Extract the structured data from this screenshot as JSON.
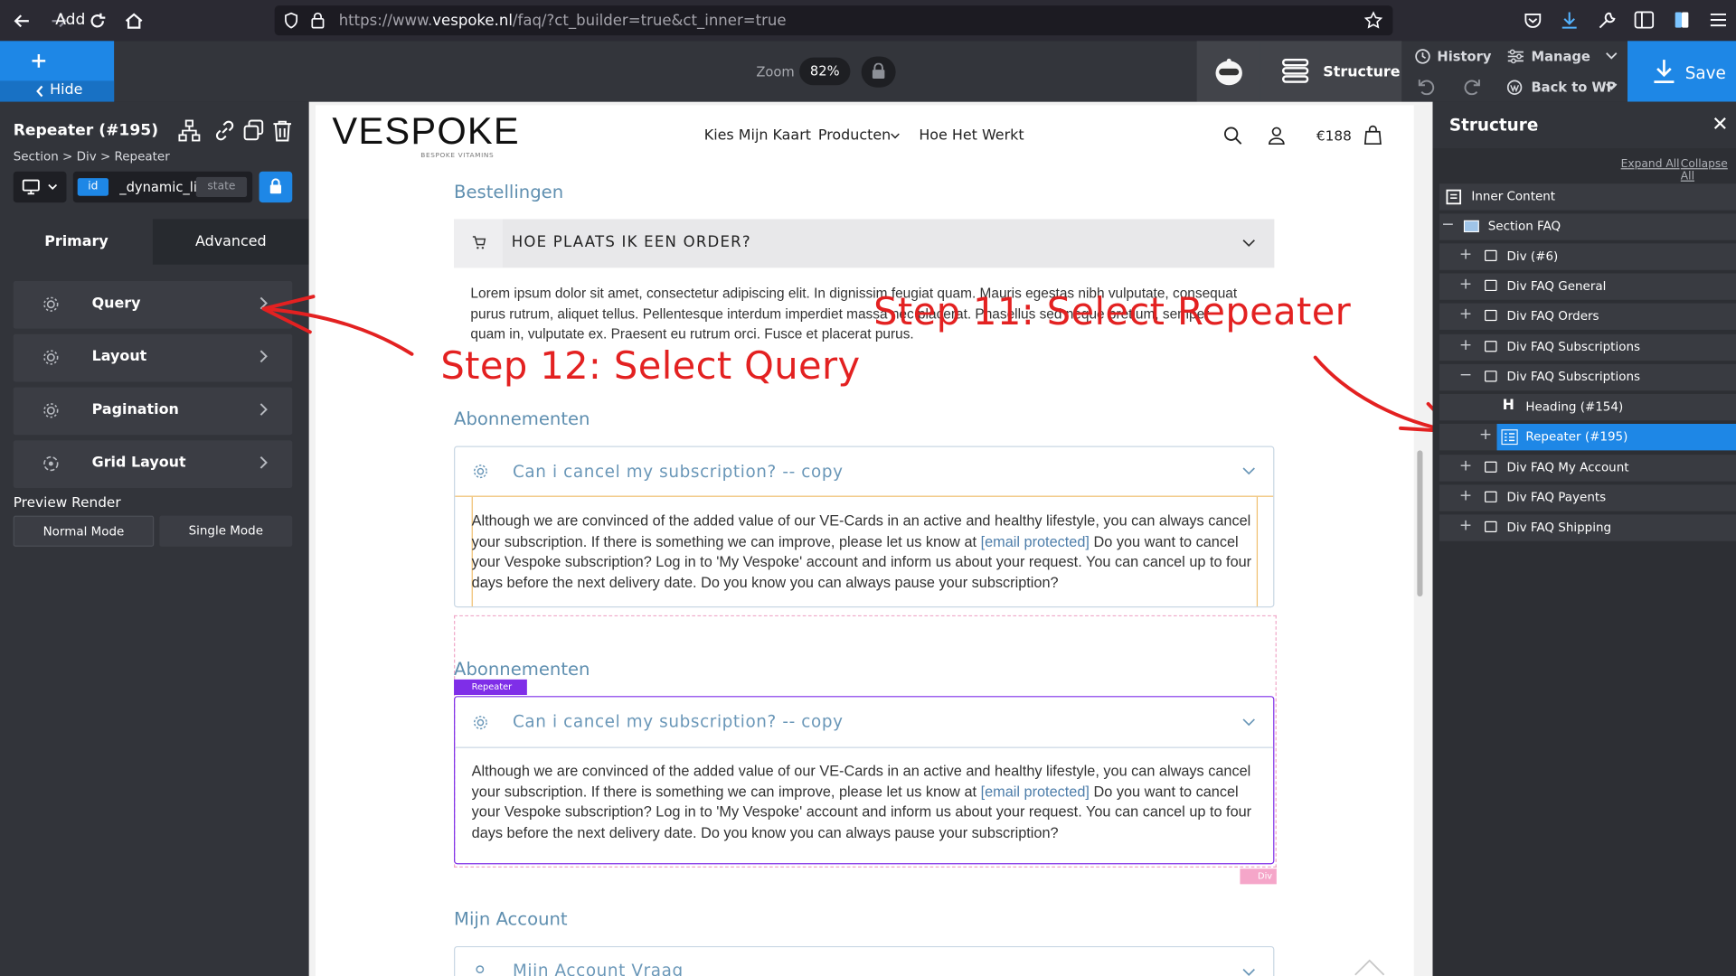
{
  "browser": {
    "url_prefix": "https://www.",
    "url_host": "vespoke.nl",
    "url_path": "/faq/?ct_builder=true&ct_inner=true"
  },
  "toolbar": {
    "add_label": "Add",
    "hide_label": "Hide",
    "zoom_label": "Zoom",
    "zoom_value": "82%",
    "structure_label": "Structure",
    "history_label": "History",
    "manage_label": "Manage",
    "back_label": "Back to WP",
    "save_label": "Save"
  },
  "left_panel": {
    "title": "Repeater (#195)",
    "breadcrumb": "Section > Div > Repeater",
    "id_tag": "id",
    "id_value": "_dynamic_li",
    "state_tag": "state",
    "tabs": [
      "Primary",
      "Advanced"
    ],
    "sections": [
      "Query",
      "Layout",
      "Pagination",
      "Grid Layout"
    ],
    "preview_label": "Preview Render",
    "modes": [
      "Normal Mode",
      "Single Mode"
    ]
  },
  "page": {
    "logo": "VESPOKE",
    "logo_sub": "BESPOKE VITAMINS",
    "nav": [
      "Kies Mijn Kaart",
      "Producten",
      "Hoe Het Werkt"
    ],
    "cart_amount": "€188",
    "sections": {
      "orders": "Bestellingen",
      "subs1": "Abonnementen",
      "subs2": "Abonnementen",
      "account": "Mijn Account"
    },
    "order_question": "HOE PLAATS IK EEN ORDER?",
    "lorem": "Lorem ipsum dolor sit amet, consectetur adipiscing elit. In dignissim feugiat quam. Mauris egestas nibh vulputate, consequat purus rutrum, aliquet tellus. Pellentesque interdum imperdiet massa nec placerat. Phasellus sed neque pretium, semper quam in, vulputate ex. Praesent eu rutrum orci. Fusce et placerat purus.",
    "sub_question": "Can i cancel my subscription? -- copy",
    "sub_answer_1": "Although we are convinced of the added value of our VE-Cards in an active and healthy lifestyle, you can always cancel your subscription. If there is something we can improve, please let us know at",
    "email_link": "[email protected]",
    "sub_answer_2": "Do you want to cancel your Vespoke subscription? Log in to 'My Vespoke' account and inform us about your request. You can cancel up to four days before the next delivery date. Do you know you can always pause your subscription?",
    "account_question": "Mijn Account Vraag",
    "repeater_tag": "Repeater",
    "div_tag": "Div"
  },
  "annotations": {
    "step11": "Step 11: Select Repeater",
    "step12": "Step 12: Select Query",
    "color": "#e32121"
  },
  "structure": {
    "title": "Structure",
    "expand_all": "Expand All",
    "collapse_all": "Collapse All",
    "items": [
      {
        "label": "Inner Content"
      },
      {
        "label": "Section FAQ"
      },
      {
        "label": "Div (#6)"
      },
      {
        "label": "Div FAQ General"
      },
      {
        "label": "Div FAQ Orders"
      },
      {
        "label": "Div FAQ Subscriptions"
      },
      {
        "label": "Div FAQ Subscriptions"
      },
      {
        "label": "Heading (#154)"
      },
      {
        "label": "Repeater (#195)"
      },
      {
        "label": "Div FAQ My Account"
      },
      {
        "label": "Div FAQ Payents"
      },
      {
        "label": "Div FAQ Shipping"
      }
    ],
    "selected_color": "#1e87e6"
  }
}
